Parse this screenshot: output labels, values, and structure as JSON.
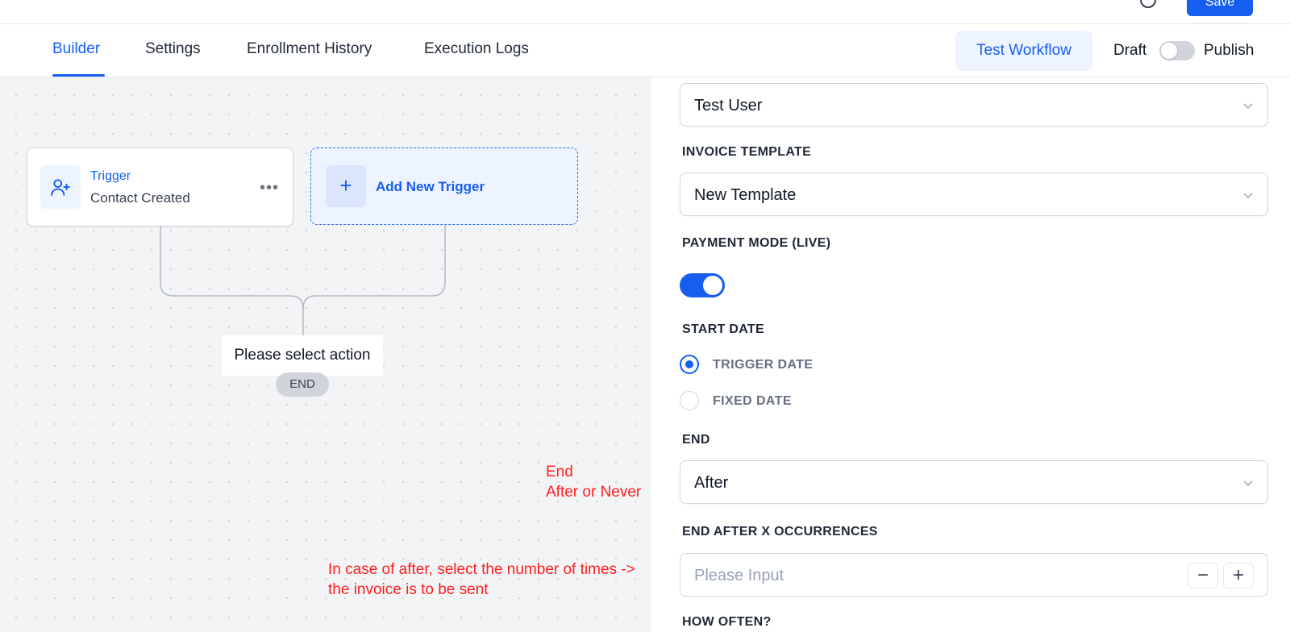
{
  "header": {
    "help_icon": "help-circle-icon",
    "save_label": "Save"
  },
  "tabs": {
    "items": [
      {
        "label": "Builder",
        "active": true
      },
      {
        "label": "Settings",
        "active": false
      },
      {
        "label": "Enrollment History",
        "active": false
      },
      {
        "label": "Execution Logs",
        "active": false
      }
    ],
    "test_workflow_label": "Test Workflow",
    "draft_label": "Draft",
    "publish_label": "Publish",
    "publish_enabled": false
  },
  "canvas": {
    "trigger": {
      "icon": "user-plus-icon",
      "title": "Trigger",
      "subtitle": "Contact Created",
      "more_icon": "more-horizontal-icon"
    },
    "add_trigger": {
      "icon": "plus-icon",
      "label": "Add New Trigger"
    },
    "select_action_label": "Please select action",
    "end_label": "END",
    "annotations": {
      "end_note_line1": "End",
      "end_note_line2": "After or Never",
      "occurrence_note_line1": "In case of after, select the number of times ->",
      "occurrence_note_line2": "the invoice is to be sent"
    }
  },
  "panel": {
    "user_select": {
      "value": "Test User"
    },
    "invoice_template": {
      "label": "INVOICE TEMPLATE",
      "value": "New Template"
    },
    "payment_mode": {
      "label": "PAYMENT MODE (LIVE)",
      "enabled": true
    },
    "start_date": {
      "label": "START DATE",
      "options": [
        {
          "label": "TRIGGER DATE",
          "checked": true
        },
        {
          "label": "FIXED DATE",
          "checked": false
        }
      ]
    },
    "end": {
      "label": "END",
      "value": "After"
    },
    "end_after": {
      "label": "END AFTER X OCCURRENCES",
      "placeholder": "Please Input",
      "value": "",
      "minus": "−",
      "plus": "+"
    },
    "how_often": {
      "label": "HOW OFTEN?"
    }
  },
  "colors": {
    "accent": "#155eef",
    "annotation": "#ff1f1f",
    "canvas_bg": "#f3f4f6"
  }
}
